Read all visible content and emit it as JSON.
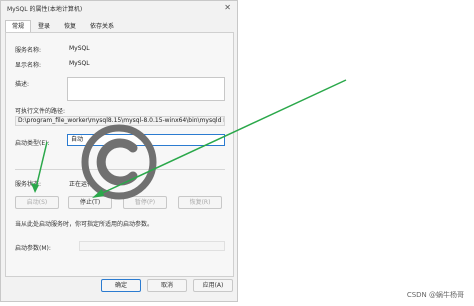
{
  "dialog": {
    "title": "MySQL 的属性(本地计算机)",
    "close_label": "✕",
    "tabs": [
      "常规",
      "登录",
      "恢复",
      "依存关系"
    ],
    "service_name_label": "服务名称:",
    "service_name_value": "MySQL",
    "display_name_label": "显示名称:",
    "display_name_value": "MySQL",
    "description_label": "描述:",
    "path_label": "可执行文件的路径:",
    "path_value": "D:\\program_file_worker\\mysql8.15\\mysql-8.0.15-winx64\\bin\\mysqld My",
    "startup_type_label": "启动类型(E):",
    "startup_type_value": "自动",
    "status_label": "服务状态:",
    "status_value": "正在运行",
    "buttons": {
      "start": "启动(S)",
      "stop": "停止(T)",
      "pause": "暂停(P)",
      "resume": "恢复(R)"
    },
    "params_hint": "当从此处启动服务时，你可指定所适用的启动参数。",
    "params_label": "启动参数(M):",
    "footer": {
      "ok": "确定",
      "cancel": "取消",
      "apply": "应用(A)"
    }
  },
  "watermark": "CSDN @蜗牛杨哥",
  "colors": {
    "arrow": "#2aa84a",
    "accent": "#2b7bd0",
    "copyright_mark": "#707070"
  }
}
